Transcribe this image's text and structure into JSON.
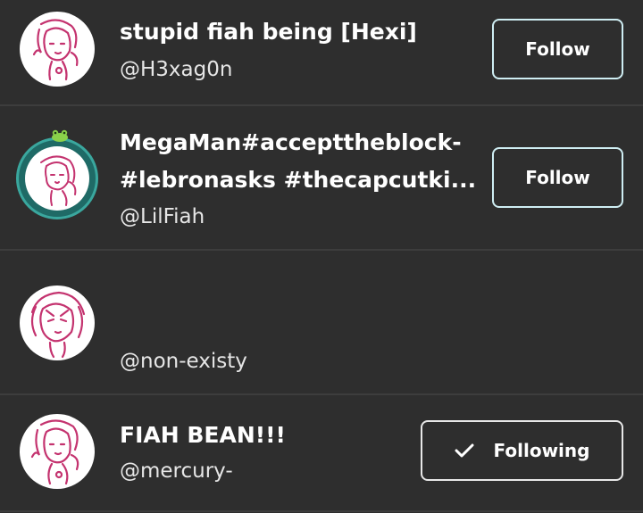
{
  "users": [
    {
      "display_name": "stupid fiah being [Hexi]",
      "handle": "@H3xag0n",
      "button_label": "Follow",
      "following": false
    },
    {
      "display_name_line1": "MegaMan#accepttheblock-",
      "display_name_line2": "#lebronasks #thecapcutki...",
      "handle": "@LilFiah",
      "button_label": "Follow",
      "following": false
    },
    {
      "display_name": "",
      "handle": "@non-existy"
    },
    {
      "display_name": "FIAH BEAN!!!",
      "handle": "@mercury-",
      "button_label": "Following",
      "following": true
    }
  ],
  "colors": {
    "background": "#2e2e2e",
    "divider": "#3d3d3d",
    "avatar_line": "#c4336f",
    "button_border": "#cfeef3",
    "ring": "#1f6a66"
  }
}
